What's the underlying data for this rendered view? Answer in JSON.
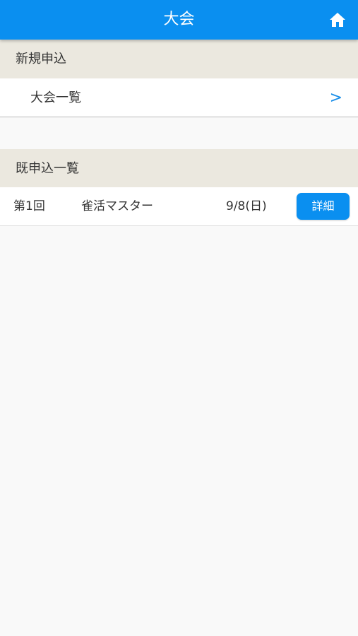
{
  "header": {
    "title": "大会",
    "home_icon": "home-icon"
  },
  "new_application": {
    "section_label": "新規申込",
    "tournament_list_label": "大会一覧",
    "chevron": ">"
  },
  "existing_applications": {
    "section_label": "既申込一覧",
    "rows": [
      {
        "round": "第1回",
        "name": "雀活マスター",
        "date": "9/8(日)",
        "detail_label": "詳細"
      }
    ]
  },
  "colors": {
    "accent": "#0a8ff0",
    "section_bg": "#ebe8df",
    "page_bg": "#f9f9f9"
  }
}
